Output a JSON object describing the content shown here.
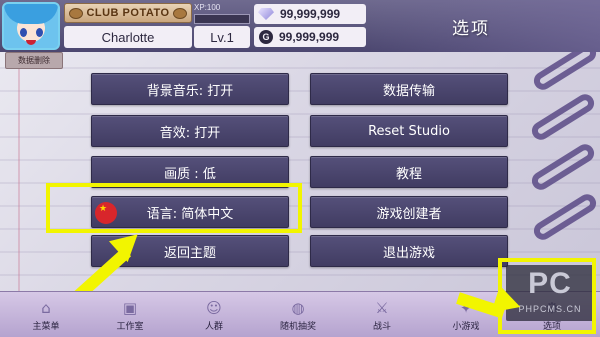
{
  "header": {
    "club_label": "CLUB POTATO",
    "player_name": "Charlotte",
    "xp_label": "XP:100",
    "xp_progress": 0.0,
    "level": "Lv.1",
    "gems": "99,999,999",
    "coins": "99,999,999",
    "coin_glyph": "G",
    "page_title": "选项"
  },
  "data_delete_label": "数据删除",
  "options": {
    "left": [
      "背景音乐: 打开",
      "音效: 打开",
      "画质 : 低",
      "语言: 简体中文",
      "返回主题"
    ],
    "right": [
      "数据传输",
      "Reset Studio",
      "教程",
      "游戏创建者",
      "退出游戏"
    ]
  },
  "bottom_nav": [
    {
      "label": "主菜单",
      "icon": "home-icon"
    },
    {
      "label": "工作室",
      "icon": "studio-icon"
    },
    {
      "label": "人群",
      "icon": "crowd-icon"
    },
    {
      "label": "随机抽奖",
      "icon": "lottery-icon"
    },
    {
      "label": "战斗",
      "icon": "battle-icon"
    },
    {
      "label": "小游戏",
      "icon": "minigame-icon"
    },
    {
      "label": "选项",
      "icon": "options-icon"
    }
  ],
  "watermark": {
    "big": "PC",
    "small": "PHPCMS.CN"
  },
  "colors": {
    "button_bg": "#4a4570",
    "highlight": "#f2f500",
    "flag_red": "#d8262b"
  }
}
